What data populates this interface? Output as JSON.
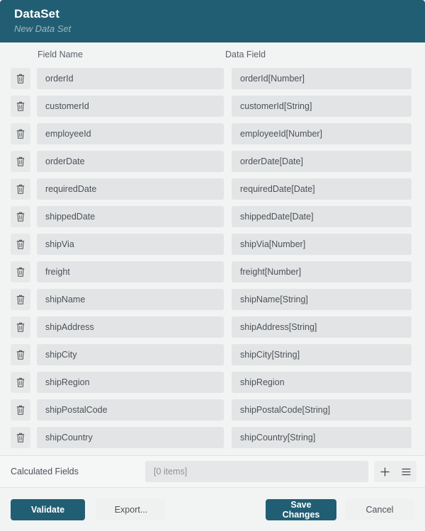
{
  "header": {
    "title": "DataSet",
    "subtitle": "New Data Set",
    "background_color": "#215e74"
  },
  "table": {
    "columns": [
      "Field Name",
      "Data Field"
    ],
    "delete_icon": "trash-icon",
    "rows": [
      {
        "field_name": "orderId",
        "data_field": "orderId[Number]"
      },
      {
        "field_name": "customerId",
        "data_field": "customerId[String]"
      },
      {
        "field_name": "employeeId",
        "data_field": "employeeId[Number]"
      },
      {
        "field_name": "orderDate",
        "data_field": "orderDate[Date]"
      },
      {
        "field_name": "requiredDate",
        "data_field": "requiredDate[Date]"
      },
      {
        "field_name": "shippedDate",
        "data_field": "shippedDate[Date]"
      },
      {
        "field_name": "shipVia",
        "data_field": "shipVia[Number]"
      },
      {
        "field_name": "freight",
        "data_field": "freight[Number]"
      },
      {
        "field_name": "shipName",
        "data_field": "shipName[String]"
      },
      {
        "field_name": "shipAddress",
        "data_field": "shipAddress[String]"
      },
      {
        "field_name": "shipCity",
        "data_field": "shipCity[String]"
      },
      {
        "field_name": "shipRegion",
        "data_field": "shipRegion"
      },
      {
        "field_name": "shipPostalCode",
        "data_field": "shipPostalCode[String]"
      },
      {
        "field_name": "shipCountry",
        "data_field": "shipCountry[String]"
      }
    ]
  },
  "calculated_fields": {
    "label": "Calculated Fields",
    "value": "[0 items]",
    "add_icon": "plus-icon",
    "menu_icon": "hamburger-menu-icon"
  },
  "footer": {
    "validate_label": "Validate",
    "export_label": "Export...",
    "save_label": "Save Changes",
    "cancel_label": "Cancel",
    "primary_color": "#215e74"
  }
}
